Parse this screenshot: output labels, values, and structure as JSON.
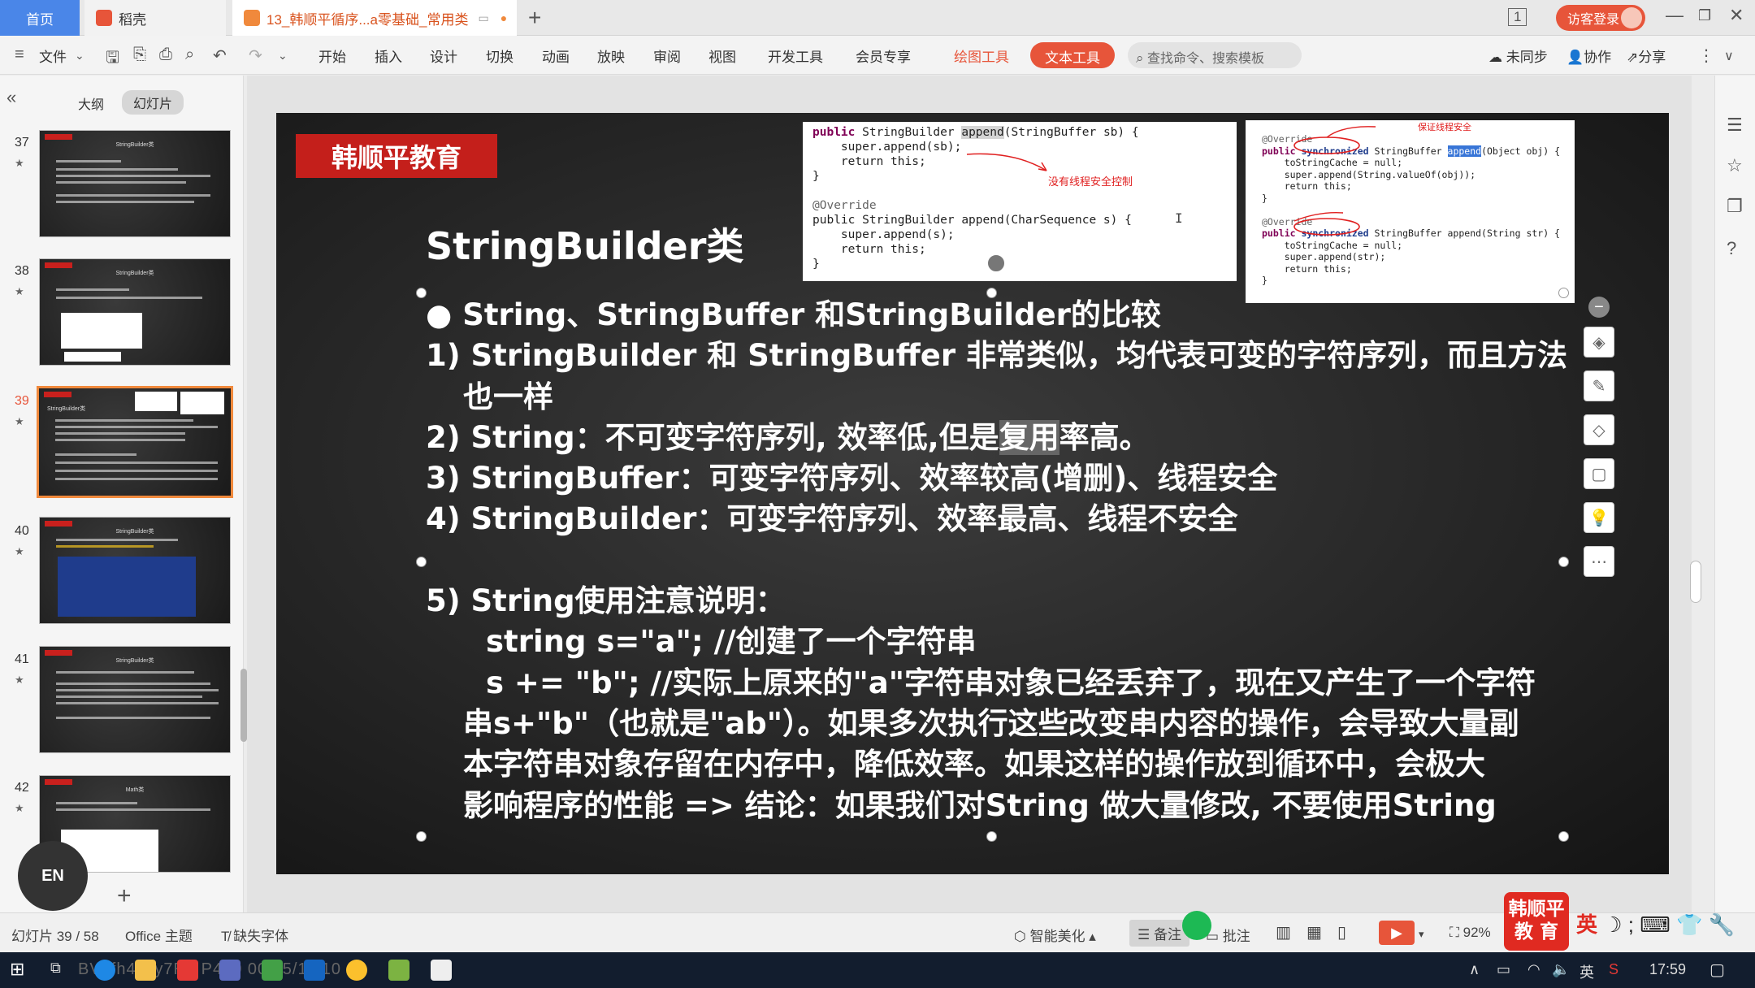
{
  "titlebar": {
    "home_tab": "首页",
    "tab1": "稻壳",
    "tab2": "13_韩顺平循序...a零基础_常用类",
    "add_tab": "+",
    "login": "访客登录",
    "page_indicator": "1"
  },
  "ribbon": {
    "file": "文件",
    "tabs": [
      "开始",
      "插入",
      "设计",
      "切换",
      "动画",
      "放映",
      "审阅",
      "视图",
      "开发工具",
      "会员专享"
    ],
    "draw_tools": "绘图工具",
    "text_tools": "文本工具",
    "search_placeholder": "查找命令、搜索模板",
    "sync": "未同步",
    "collab": "协作",
    "share": "分享"
  },
  "left_panel": {
    "collapse": "«",
    "outline": "大纲",
    "slides": "幻灯片",
    "thumbnails": [
      {
        "num": "37",
        "title": "StringBuilder类"
      },
      {
        "num": "38",
        "title": "StringBuilder类"
      },
      {
        "num": "39",
        "title": "StringBuilder类"
      },
      {
        "num": "40",
        "title": "StringBuilder类"
      },
      {
        "num": "41",
        "title": "StringBuilder类"
      },
      {
        "num": "42",
        "title": "Math类"
      }
    ],
    "star": "★",
    "en_badge": "EN",
    "add_slide": "+"
  },
  "slide": {
    "brand": "韩顺平教育",
    "title": "StringBuilder类",
    "bullet": "●",
    "heading": "String、StringBuffer 和StringBuilder的比较",
    "item1a": "1) StringBuilder 和 StringBuffer 非常类似，均代表可变的字符序列，而且方法",
    "item1b": "也一样",
    "item2_pre": "2) String：不可变字符序列, 效率低,但是",
    "item2_hl": "复用",
    "item2_post": "率高。",
    "item3": "3) StringBuffer：可变字符序列、效率较高(增删)、线程安全",
    "item4": "4) StringBuilder：可变字符序列、效率最高、线程不安全",
    "item5": "5) String使用注意说明：",
    "code_line1": "string s=\"a\"; //创建了一个字符串",
    "code_line2": "s += \"b\"; //实际上原来的\"a\"字符串对象已经丢弃了，现在又产生了一个字符",
    "code_line3": "串s+\"b\"（也就是\"ab\"）。如果多次执行这些改变串内容的操作，会导致大量副",
    "code_line4": "本字符串对象存留在内存中，降低效率。如果这样的操作放到循环中，会极大",
    "code_line5": "影响程序的性能 => 结论：如果我们对String 做大量修改, 不要使用String",
    "code_img1": {
      "l1_pre": "public StringBuilder ",
      "l1_hl": "append",
      "l1_post": "(StringBuffer sb) {",
      "l2": "    super.append(sb);",
      "l3": "    return this;",
      "l4": "}",
      "l5": "@Override",
      "l6": "public StringBuilder append(CharSequence s) {",
      "l7": "    super.append(s);",
      "l8": "    return this;",
      "l9": "}",
      "annotation": "没有线程安全控制"
    },
    "code_img2": {
      "l1": "@Override",
      "l2_pre": "public synchronized StringBuffer ",
      "l2_hl": "append",
      "l2_post": "(Object obj) {",
      "l3": "    toStringCache = null;",
      "l4": "    super.append(String.valueOf(obj));",
      "l5": "    return this;",
      "l6": "}",
      "l7": "@Override",
      "l8": "public synchronized StringBuffer append(String str) {",
      "l9": "    toStringCache = null;",
      "l10": "    super.append(str);",
      "l11": "    return this;",
      "l12": "}",
      "annotation": "保证线程安全"
    }
  },
  "statusbar": {
    "slide_count": "幻灯片 39 / 58",
    "theme": "Office 主题",
    "missing_font": "缺失字体",
    "beautify": "智能美化",
    "notes": "备注",
    "comment": "批注",
    "zoom": "92%"
  },
  "ime": {
    "logo_line1": "韩顺平",
    "logo_line2": "教 育",
    "ying": "英"
  },
  "taskbar": {
    "watermark": "BV1fh411y7R8 P480 00:55/11:10",
    "lang": "英",
    "time": "17:59"
  }
}
